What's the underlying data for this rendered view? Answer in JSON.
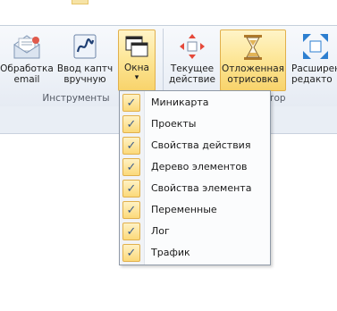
{
  "ribbon": {
    "buttons": {
      "email": {
        "label": "Обработка\nemail",
        "icon": "envelope-icon"
      },
      "captcha": {
        "label": "Ввод каптч\nвручную",
        "icon": "captcha-icon"
      },
      "windows": {
        "label": "Окна",
        "icon": "windows-icon",
        "arrow": "▾"
      },
      "current_action": {
        "label": "Текущее\nдействие",
        "icon": "target-arrows-icon"
      },
      "deferred_render": {
        "label": "Отложенная\nотрисовка",
        "icon": "hourglass-icon"
      },
      "extended_editor": {
        "label": "Расширенн\nредакто",
        "icon": "expand-arrows-icon"
      }
    },
    "groups": {
      "tools": "Инструменты",
      "editor_tail": "тор"
    }
  },
  "windows_menu": {
    "items": [
      {
        "label": "Миникарта",
        "checked": true
      },
      {
        "label": "Проекты",
        "checked": true
      },
      {
        "label": "Свойства действия",
        "checked": true
      },
      {
        "label": "Дерево элементов",
        "checked": true
      },
      {
        "label": "Свойства элемента",
        "checked": true
      },
      {
        "label": "Переменные",
        "checked": true
      },
      {
        "label": "Лог",
        "checked": true
      },
      {
        "label": "Трафик",
        "checked": true
      }
    ],
    "check_glyph": "✓"
  },
  "colors": {
    "highlight": "#f8d36b",
    "highlight_border": "#e1b04c",
    "ribbon_bg": "#eef2f8"
  }
}
